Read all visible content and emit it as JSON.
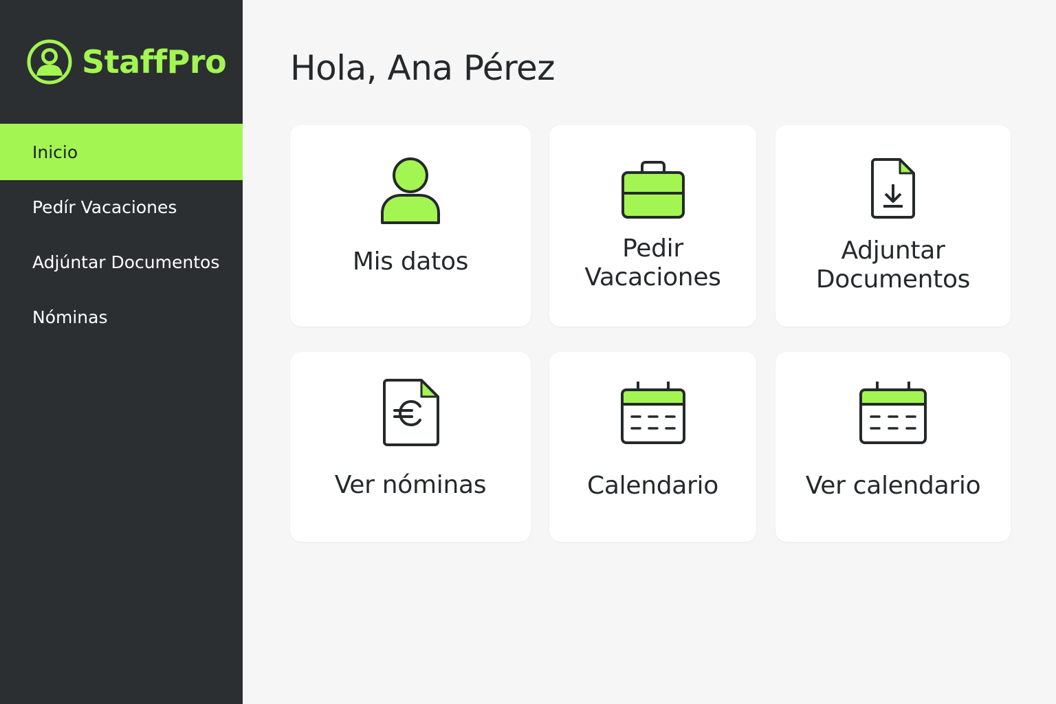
{
  "brand": {
    "name": "StaffPro",
    "logo_icon": "user-circle-icon"
  },
  "colors": {
    "accent": "#a3f552",
    "sidebar_bg": "#2b2f31",
    "page_bg": "#f6f6f6",
    "text_dark": "#25292b"
  },
  "sidebar": {
    "items": [
      {
        "label": "Inicio",
        "active": true
      },
      {
        "label": "Pedír Vacaciones",
        "active": false
      },
      {
        "label": "Adjúntar Documentos",
        "active": false
      },
      {
        "label": "Nóminas",
        "active": false
      }
    ]
  },
  "main": {
    "greeting": "Hola, Ana Pérez",
    "cards": [
      {
        "lines": [
          "Mis datos"
        ],
        "icon": "user-icon"
      },
      {
        "lines": [
          "Pedir",
          "Vacaciones"
        ],
        "icon": "briefcase-icon"
      },
      {
        "lines": [
          "Adjuntar",
          "Documentos"
        ],
        "icon": "document-download-icon"
      },
      {
        "lines": [
          "Ver nóminas"
        ],
        "icon": "euro-document-icon"
      },
      {
        "lines": [
          "Calendario"
        ],
        "icon": "calendar-icon"
      },
      {
        "lines": [
          "Ver calendario"
        ],
        "icon": "calendar-icon"
      }
    ]
  }
}
